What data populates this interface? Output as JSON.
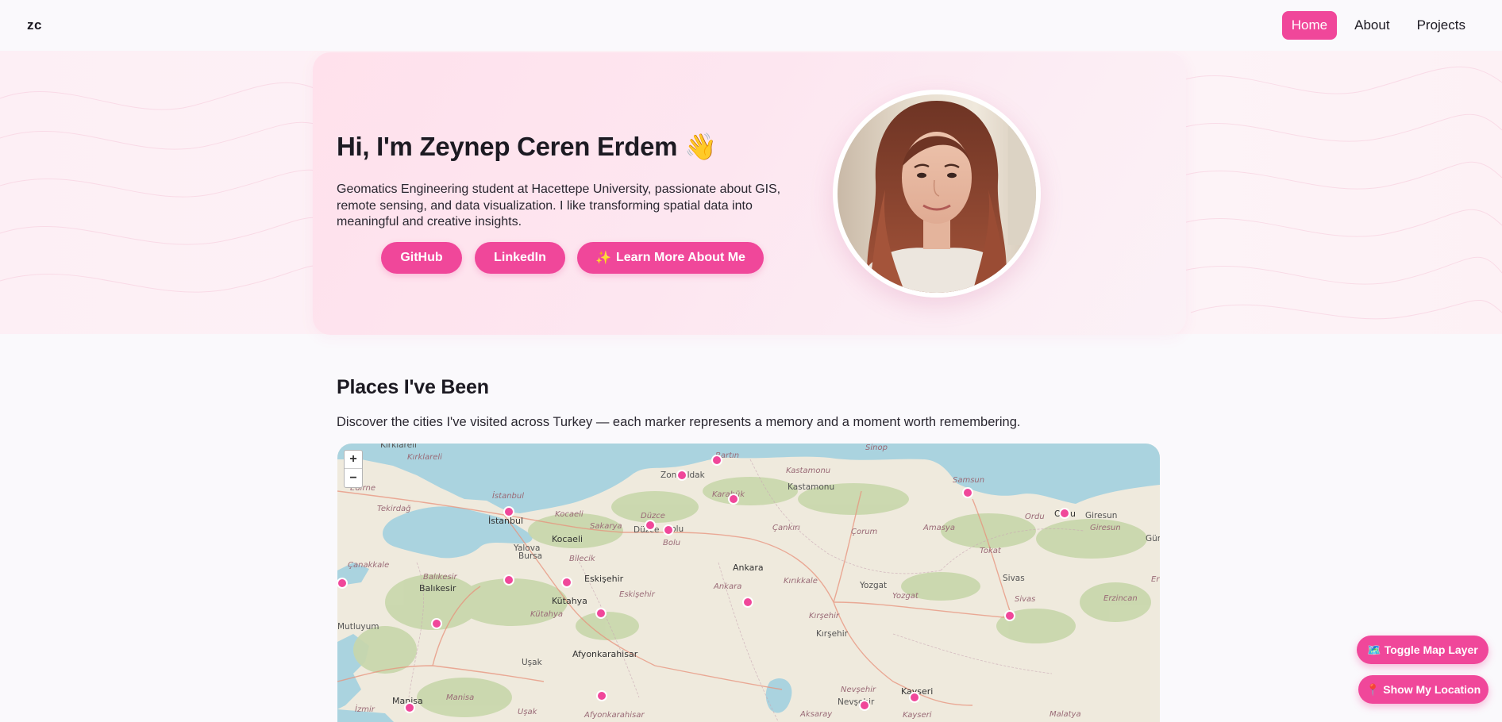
{
  "nav": {
    "logo": "zc",
    "links": [
      {
        "label": "Home",
        "active": true
      },
      {
        "label": "About",
        "active": false
      },
      {
        "label": "Projects",
        "active": false
      }
    ]
  },
  "hero": {
    "title": "Hi, I'm Zeynep Ceren Erdem 👋",
    "description": "Geomatics Engineering student at Hacettepe University, passionate about GIS, remote sensing, and data visualization. I like transforming spatial data into meaningful and creative insights.",
    "buttons": {
      "github": "GitHub",
      "linkedin": "LinkedIn",
      "more_icon": "✨",
      "more": "Learn More About Me"
    },
    "avatar_icon": "profile-photo"
  },
  "places": {
    "title": "Places I've Been",
    "description": "Discover the cities I've visited across Turkey — each marker represents a memory and a moment worth remembering."
  },
  "map": {
    "zoom_in": "+",
    "zoom_out": "−",
    "labels": {
      "kirklareli": "Kırklareli",
      "kirklareli_it": "Kırklareli",
      "edirne": "Edirne",
      "tekirdag": "Tekirdağ",
      "istanbul_it": "İstanbul",
      "istanbul": "İstanbul",
      "kocaeli_it": "Kocaeli",
      "kocaeli": "Kocaeli",
      "sakarya": "Sakarya",
      "yalova": "Yalova",
      "duzce_it": "Düzce",
      "duzce": "Düzce",
      "bolu": "Bolu",
      "zonguldak": "Zonguldak",
      "bartin": "Bartın",
      "karabuk": "Karabük",
      "kastamonu_it": "Kastamonu",
      "kastamonu": "Kastamonu",
      "sinop": "Sinop",
      "samsun": "Samsun",
      "ordu": "Ordu",
      "ordu_it": "Ordu",
      "giresun": "Giresun",
      "giresun_it": "Giresun",
      "gum": "Güm",
      "cankiri": "Çankırı",
      "corum": "Çorum",
      "amasya": "Amasya",
      "tokat": "Tokat",
      "canakkale": "Çanakkale",
      "balikesir_it": "Balıkesir",
      "balikesir": "Balıkesir",
      "bursa": "Bursa",
      "bilecik": "Bilecik",
      "eskisehir": "Eskişehir",
      "eskisehir_it": "Eskişehir",
      "ankara": "Ankara",
      "ankara_it": "Ankara",
      "kirikkale": "Kırıkkale",
      "yozgat": "Yozgat",
      "yozgat_it": "Yozgat",
      "sivas": "Sivas",
      "sivas_it": "Sivas",
      "erzincan": "Erzincan",
      "er": "Er",
      "kutahya": "Kütahya",
      "kutahya_it": "Kütahya",
      "kirsehir": "Kırşehir",
      "kirsehir_it": "Kırşehir",
      "mutluyum": "Mutluyum",
      "afyon": "Afyonkarahisar",
      "afyon_it": "Afyonkarahisar",
      "usak": "Uşak",
      "usak_it": "Uşak",
      "manisa": "Manisa",
      "manisa_it": "Manisa",
      "izmir": "İzmir",
      "nevsehir": "Nevşehir",
      "nevsehir2": "Nevşehir",
      "kayseri": "Kayseri",
      "kayseri_it": "Kayseri",
      "aksaray": "Aksaray",
      "malatya": "Malatya"
    }
  },
  "floating": {
    "toggle_icon": "🗺️",
    "toggle": "Toggle Map Layer",
    "location_icon": "📍",
    "location": "Show My Location"
  },
  "colors": {
    "accent": "#f0479a",
    "sea": "#aad3df",
    "land": "#efeadd",
    "forest": "#c8d7ab",
    "marker": "#f0479a"
  }
}
